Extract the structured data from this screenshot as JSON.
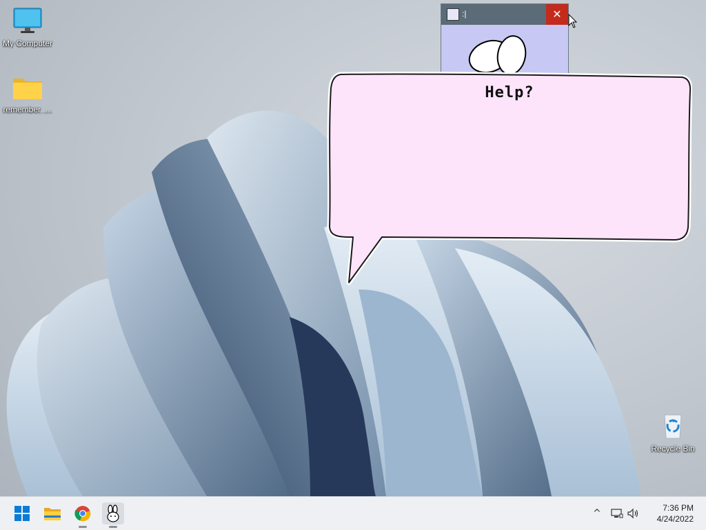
{
  "desktop": {
    "icons": [
      {
        "label": "My Computer",
        "icon": "monitor-icon"
      },
      {
        "label": "remember_...",
        "icon": "folder-icon"
      },
      {
        "label": "Recycle Bin",
        "icon": "recycle-bin-icon"
      }
    ]
  },
  "app_window": {
    "title": ":|",
    "close_symbol": "✕",
    "title_bar_color": "#5b6b77",
    "body_color": "#c8c8f4"
  },
  "speech_bubble": {
    "text": "Help?",
    "fill_color": "#fde4fb",
    "stroke_color": "#1a1a1a"
  },
  "taskbar": {
    "pinned": [
      {
        "name": "start-button",
        "icon": "windows-logo-icon"
      },
      {
        "name": "file-explorer",
        "icon": "folder-icon"
      },
      {
        "name": "chrome",
        "icon": "chrome-icon"
      },
      {
        "name": "pet-app",
        "icon": "bunny-icon",
        "active": true
      }
    ],
    "tray": {
      "show_hidden": "^",
      "icons": [
        "network-icon",
        "volume-icon"
      ]
    },
    "clock": {
      "time": "7:36 PM",
      "date": "4/24/2022"
    }
  }
}
